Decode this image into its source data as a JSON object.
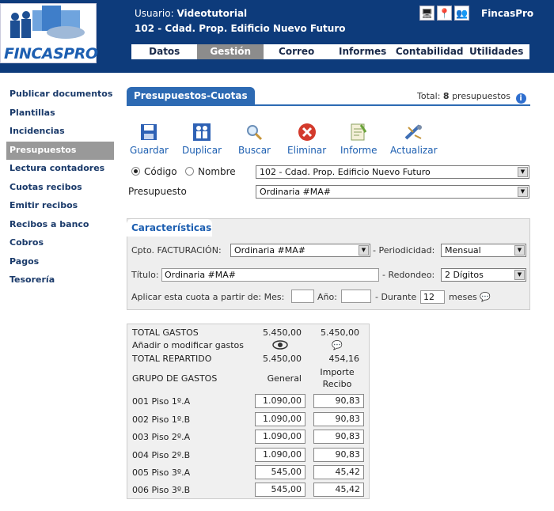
{
  "header": {
    "user_label": "Usuario:",
    "user_name": "Videotutorial",
    "community": "102 - Cdad. Prop. Edificio Nuevo Futuro",
    "brand": "FincasPro",
    "logo_text": "FINCASPRO",
    "icons": [
      "monitor-icon",
      "map-pin-icon",
      "users-icon"
    ]
  },
  "menu": [
    {
      "label": "Datos",
      "active": false
    },
    {
      "label": "Gestión",
      "active": true
    },
    {
      "label": "Correo",
      "active": false
    },
    {
      "label": "Informes",
      "active": false
    },
    {
      "label": "Contabilidad",
      "active": false
    },
    {
      "label": "Utilidades",
      "active": false
    }
  ],
  "sidebar": [
    {
      "label": "Publicar documentos",
      "active": false
    },
    {
      "label": "Plantillas",
      "active": false
    },
    {
      "label": "Incidencias",
      "active": false
    },
    {
      "label": "Presupuestos",
      "active": true
    },
    {
      "label": "Lectura contadores",
      "active": false
    },
    {
      "label": "Cuotas recibos",
      "active": false
    },
    {
      "label": "Emitir recibos",
      "active": false
    },
    {
      "label": "Recibos a banco",
      "active": false
    },
    {
      "label": "Cobros",
      "active": false
    },
    {
      "label": "Pagos",
      "active": false
    },
    {
      "label": "Tesorería",
      "active": false
    }
  ],
  "tab_title": "Presupuestos-Cuotas",
  "total": {
    "label": "Total:",
    "count": "8",
    "unit": "presupuestos"
  },
  "toolbar": [
    {
      "label": "Guardar",
      "icon": "save-icon"
    },
    {
      "label": "Duplicar",
      "icon": "duplicate-icon"
    },
    {
      "label": "Buscar",
      "icon": "search-icon"
    },
    {
      "label": "Eliminar",
      "icon": "delete-icon"
    },
    {
      "label": "Informe",
      "icon": "report-icon"
    },
    {
      "label": "Actualizar",
      "icon": "refresh-icon"
    }
  ],
  "selector": {
    "radio_codigo": "Código",
    "radio_nombre": "Nombre",
    "community_value": "102 - Cdad. Prop. Edificio Nuevo Futuro",
    "presupuesto_label": "Presupuesto",
    "presupuesto_value": "Ordinaria #MA#"
  },
  "caracteristicas": {
    "tab": "Características",
    "cpto_label": "Cpto. FACTURACIÓN:",
    "cpto_value": "Ordinaria #MA#",
    "periodicidad_label": "- Periodicidad:",
    "periodicidad_value": "Mensual",
    "titulo_label": "Título:",
    "titulo_value": "Ordinaria #MA#",
    "redondeo_label": "- Redondeo:",
    "redondeo_value": "2 Dígitos",
    "aplicar_label": "Aplicar esta cuota a partir de: Mes:",
    "ano_label": "Año:",
    "durante_label": "- Durante",
    "durante_value": "12",
    "meses_label": "meses"
  },
  "gastos": {
    "total_gastos_label": "TOTAL GASTOS",
    "total_gastos_general": "5.450,00",
    "total_gastos_importe": "5.450,00",
    "anadir_label": "Añadir o modificar gastos",
    "total_repartido_label": "TOTAL REPARTIDO",
    "total_repartido_general": "5.450,00",
    "total_repartido_importe": "454,16",
    "grupo_label": "GRUPO DE GASTOS",
    "col_general": "General",
    "col_importe_1": "Importe",
    "col_importe_2": "Recibo",
    "rows": [
      {
        "name": "001 Piso 1º.A",
        "general": "1.090,00",
        "importe": "90,83"
      },
      {
        "name": "002 Piso 1º.B",
        "general": "1.090,00",
        "importe": "90,83"
      },
      {
        "name": "003 Piso 2º.A",
        "general": "1.090,00",
        "importe": "90,83"
      },
      {
        "name": "004 Piso 2º.B",
        "general": "1.090,00",
        "importe": "90,83"
      },
      {
        "name": "005 Piso 3º.A",
        "general": "545,00",
        "importe": "45,42"
      },
      {
        "name": "006 Piso 3º.B",
        "general": "545,00",
        "importe": "45,42"
      }
    ]
  }
}
